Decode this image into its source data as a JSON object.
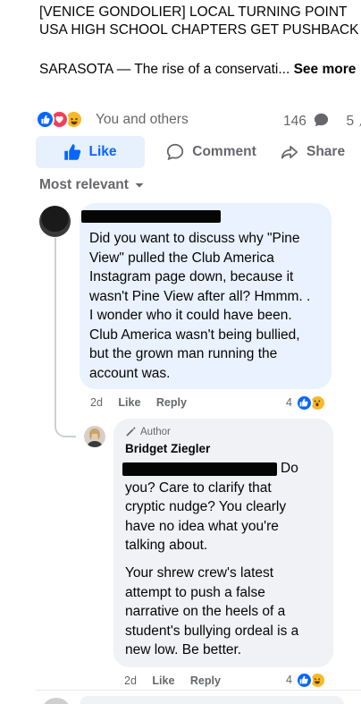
{
  "post": {
    "headline_line1": "[VENICE GONDOLIER] LOCAL TURNING POINT",
    "headline_line2": "USA HIGH SCHOOL CHAPTERS GET PUSHBACK",
    "body_preview": "SARASOTA — The rise of a conservati...",
    "see_more": "See more"
  },
  "reactions": {
    "summary": "You and others",
    "comments_count": "146",
    "shares_count": "5",
    "icons": [
      "like-icon",
      "love-icon",
      "haha-icon"
    ]
  },
  "actions": {
    "like": "Like",
    "comment": "Comment",
    "share": "Share"
  },
  "sort": {
    "label": "Most relevant"
  },
  "comments": [
    {
      "author": "",
      "text_lines": [
        "Did you want to discuss why \"Pine",
        "View\" pulled the Club America",
        "Instagram page down, because it",
        "wasn't Pine View after all? Hmmm. .",
        "I wonder who it could have been.",
        "Club America wasn't being bullied,",
        "but the grown man running the",
        "account was."
      ],
      "time": "2d",
      "like": "Like",
      "reply": "Reply",
      "reaction_count": "4",
      "reaction_icons": [
        "like-icon",
        "wow-icon"
      ]
    },
    {
      "badge": "Author",
      "author": "Bridget Ziegler",
      "text_lines": [
        "Do",
        "you? Care to clarify that",
        "cryptic nudge? You clearly",
        "have no idea what you're",
        "talking about."
      ],
      "text2_lines": [
        "Your shrew crew's latest",
        "attempt to push a false",
        "narrative on the heels of a",
        "student's bullying ordeal is a",
        "new low. Be better."
      ],
      "time": "2d",
      "like": "Like",
      "reply": "Reply",
      "reaction_count": "4",
      "reaction_icons": [
        "like-icon",
        "haha-icon"
      ]
    }
  ],
  "colors": {
    "facebook_blue": "#0866ff",
    "secondary_text": "#65676b",
    "comment_bubble_highlight": "#e9f2fe",
    "comment_bubble": "#f0f2f5",
    "love_red": "#f33e58",
    "emoji_yellow": "#f7b928"
  }
}
